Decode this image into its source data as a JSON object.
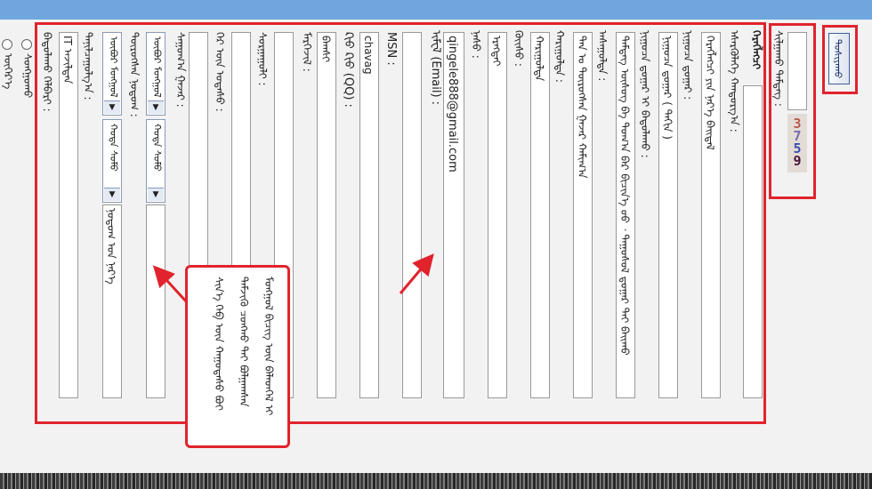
{
  "colors": {
    "accent": "#6fa6dd",
    "highlight": "#e0232c"
  },
  "submit": {
    "label": "ᠲᠤᠰᠢᠶᠠᠬᠤ"
  },
  "captcha": {
    "label": "ᠰᠢᠯᠭᠠᠬᠤ ᠲᠡᠮᠳᠡᠭ :",
    "input_value": "",
    "code": [
      "3",
      "7",
      "5",
      "9"
    ]
  },
  "form": {
    "rows": [
      {
        "label": "ᠬᠡᠷᠡᠭᠯᠡᠭᠴᠢ",
        "value": "ᠡᠰᠡᠷᠭᠦᠯᠡᠭᠡ ᠬᠠᠨᠳᠤᠷᠭ᠎ᠠ :"
      },
      {
        "label": "ᠬᠡᠷᠡᠭᠯᠡᠭᠴᠢ ᠶᠢᠨ ᠨᠡᠷ᠎ᠡ :",
        "value": "ᠬᠡᠷᠡᠭᠯᠡᠭᠴᠢ ᠶᠢᠨ ᠨᠡᠷ᠎ᠡ ᠪᠠᠢᠳᠠᠯ"
      },
      {
        "label": "ᠨᠢᠭᠤᠴᠠ ᠳ᠋ᠤᠭᠠᠷ :",
        "value": "ᠨᠢᠭᠤᠴᠠ ᠳ᠋ᠤᠭᠠᠷ ( ᠳᠠᠬᠢᠨ )"
      },
      {
        "label": "ᠨᠢᠭᠤᠴᠠ ᠳ᠋ᠤᠭᠠᠷ ᠢ ᠪᠠᠲᠤᠯᠠᠬᠤ :",
        "value": "ᠲᠡᠮᠳᠡᠭ ᠦᠰᠦᠭ ᠪᠠ ᠲᠤᠭ᠎ᠠ ᠪᠡᠷ ᠪᠢᠴᠢᠨ᠎ᠡ ᠦᠦ ᠂ ᠳᠠᠭᠤᠰᠤᠯ ᠳ᠋ᠤᠭᠠᠷ ᠲᠠᠢ ᠪᠠᠢᠬᠤ"
      },
      {
        "label": "ᠠᠰᠠᠭᠤᠯᠲᠠ :",
        "value": "ᠲᠠᠨ ᠤ ᠲᠦᠷᠦᠭᠰᠡᠨ ᠭᠠᠵᠠᠷ ᠬᠠᠮᠢᠭ᠎ᠠ"
      },
      {
        "label": "ᠬᠠᠷᠢᠭᠤᠯᠲᠠ :",
        "value": "ᠬᠠᠷᠢᠭᠤᠯᠲᠠ"
      },
      {
        "label": "ᠬᠦᠢᠰᠦ :",
        "value": "ᠡᠷᠡᠭᠲᠡᠢ"
      },
      {
        "label": "ᠨᠠᠰᠤ :",
        "value": ""
      },
      {
        "label": "ᠢᠮᠸᠯ (Email) :",
        "value": "qingele888@gmail.com"
      },
      {
        "label": "MSN :",
        "value": ""
      },
      {
        "label": "ᠺᠢᠦ ᠺᠢᠦ (QQ) :",
        "value": "chavag"
      },
      {
        "label": "ᠮᠡᠷᠭᠡᠵᠢᠯ :",
        "value": "ᠪᠠᠭᠰᠢ"
      },
      {
        "label": "ᠰᠤᠷᠭᠠᠭᠤᠯᠢ :",
        "value": ""
      },
      {
        "label": "ᠭᠡᠷ ᠦᠨ ᠤᠲᠠᠰᠤ :",
        "value": ""
      }
    ],
    "address_label": "ᠰᠠᠭᠤᠭ᠎ᠠ ᠭᠠᠵᠠᠷ :",
    "address_select_1": "ᠥᠪᠦᠷ ᠮᠤᠩᠭᠤᠯ",
    "address_select_2": "ᠬᠤᠲᠠ ᠰᠤᠮᠤ",
    "hometown_label": "ᠲᠦᠷᠦᠭᠰᠡᠨ ᠨᠤᠲᠤᠭ :",
    "hometown_select_1": "ᠥᠪᠦᠷ ᠮᠤᠩᠭᠤᠯ",
    "hometown_select_2": "ᠬᠤᠲᠠ ᠰᠤᠮᠤ",
    "hometown_input": "ᠨᠤᠲᠤᠭ ᠤᠨ ᠨᠡᠷ᠎ᠡ",
    "intro_label": "ᠲᠠᠨᠢᠯᠴᠠᠭᠤᠯᠭ᠎ᠠ :",
    "intro_value": "IT ᠠᠵᠢᠯᠲᠠᠨ",
    "radio_label": "ᠪᠠᠲᠤᠯᠠᠬᠤ ᠬᠡᠯᠪᠡᠷᠢ :",
    "radio_1": "ᠰᠣᠩᠭᠣᠬᠤ",
    "radio_2": "ᠥᠭᠡᠷ᠎ᠡ"
  },
  "callout": {
    "lines": [
      "ᠮᠤᠩᠭᠤᠯ ᠪᠢᠴᠢᠭ ᠦᠨ ᠪᠡᠯᠡᠳᠬᠡᠯ ᠢ",
      "ᠳᠡᠮᠵᠢᠬᠦ ᠴᠣᠩᠬᠣ ᠲᠠᠢ ᠪᠣᠯᠭᠠᠭᠰᠠᠨ",
      "ᠰᠢᠨ᠎ᠡ ᠬᠡᠪ ᠦᠨ ᠬᠠᠭᠤᠳᠠᠰᠤ ᠪᠤᠢ"
    ]
  }
}
